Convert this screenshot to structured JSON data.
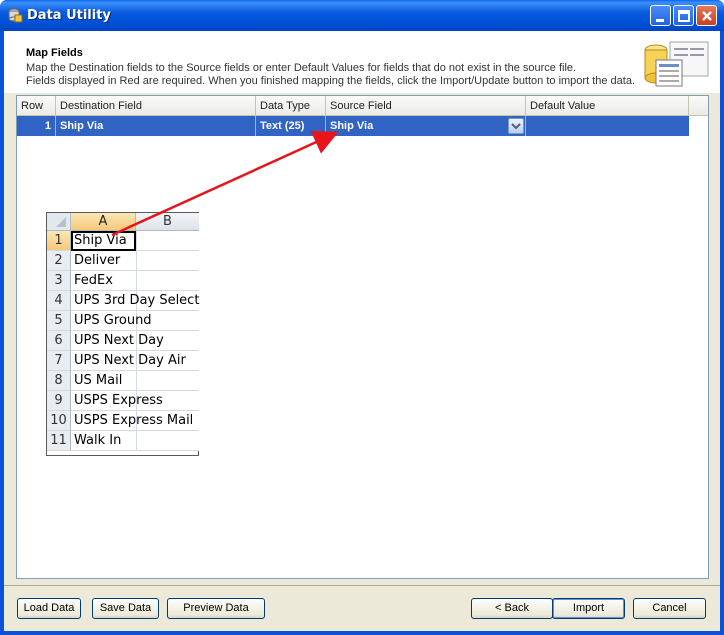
{
  "window": {
    "title": "Data Utility"
  },
  "header": {
    "title": "Map Fields",
    "line1": "Map the Destination fields to the Source fields or enter Default Values for fields that do not exist in the source file.",
    "line2": "Fields displayed in Red are required.  When you finished mapping the fields, click the Import/Update button to import the data.",
    "icon": "database-mapping-icon"
  },
  "grid": {
    "columns": [
      "Row",
      "Destination Field",
      "Data Type",
      "Source Field",
      "Default Value"
    ],
    "rows": [
      {
        "row": "1",
        "destination": "Ship Via",
        "data_type": "Text (25)",
        "source": "Ship Via",
        "default": ""
      }
    ]
  },
  "spreadsheet": {
    "columns": [
      "A",
      "B"
    ],
    "rows": [
      {
        "num": "1",
        "a": "Ship Via"
      },
      {
        "num": "2",
        "a": "Deliver"
      },
      {
        "num": "3",
        "a": "FedEx"
      },
      {
        "num": "4",
        "a": "UPS 3rd Day Select"
      },
      {
        "num": "5",
        "a": "UPS Ground"
      },
      {
        "num": "6",
        "a": "UPS Next Day"
      },
      {
        "num": "7",
        "a": "UPS Next Day Air"
      },
      {
        "num": "8",
        "a": "US Mail"
      },
      {
        "num": "9",
        "a": "USPS Express"
      },
      {
        "num": "10",
        "a": "USPS Express Mail"
      },
      {
        "num": "11",
        "a": "Walk In"
      }
    ]
  },
  "buttons": {
    "load": "Load Data",
    "save": "Save Data",
    "preview": "Preview Data",
    "back": "< Back",
    "import": "Import",
    "cancel": "Cancel"
  },
  "colors": {
    "selection": "#3163c5",
    "arrow": "#e8141b",
    "titlebar": "#0a5be0"
  }
}
